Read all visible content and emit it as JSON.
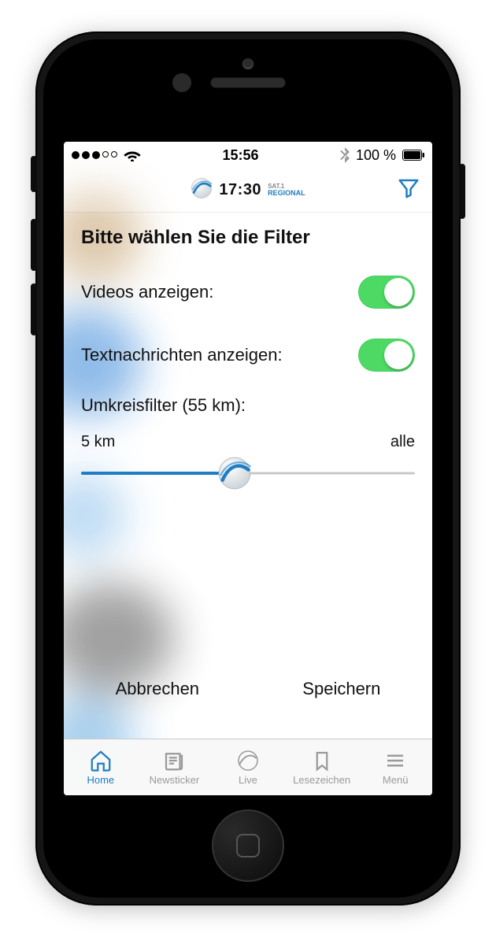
{
  "statusbar": {
    "time": "15:56",
    "battery_text": "100 %"
  },
  "header": {
    "brand_time": "17:30",
    "brand_line1": "SAT.1",
    "brand_line2": "REGIONAL"
  },
  "filter": {
    "title": "Bitte wählen Sie die Filter",
    "videos_label": "Videos anzeigen:",
    "videos_on": true,
    "text_label": "Textnachrichten anzeigen:",
    "text_on": true,
    "radius_label": "Umkreisfilter (55 km):",
    "radius_value_km": 55,
    "slider_min_label": "5 km",
    "slider_max_label": "alle",
    "slider_percent": 46
  },
  "buttons": {
    "cancel": "Abbrechen",
    "save": "Speichern"
  },
  "tabs": {
    "home": "Home",
    "newsticker": "Newsticker",
    "live": "Live",
    "bookmarks": "Lesezeichen",
    "menu": "Menü",
    "active": "home"
  }
}
